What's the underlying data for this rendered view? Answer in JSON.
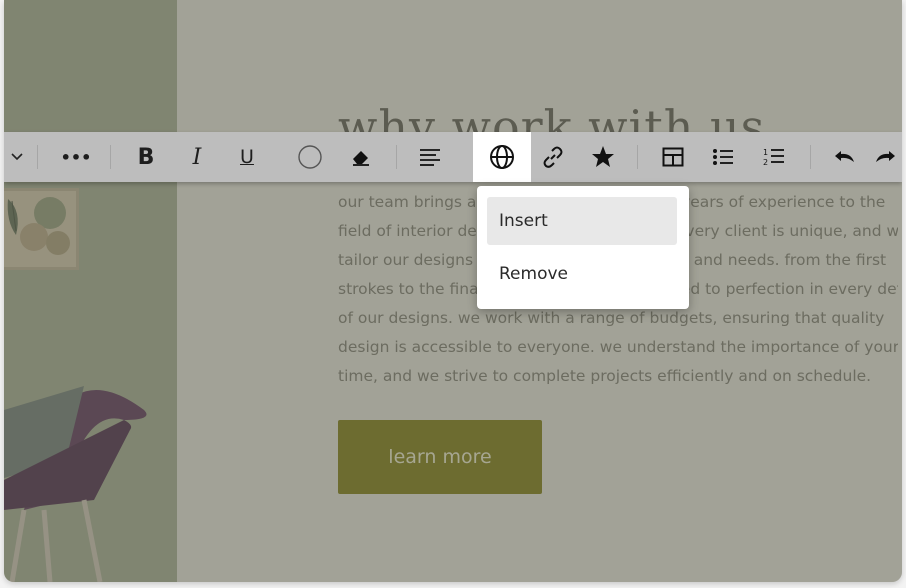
{
  "page": {
    "heading": "why work with us",
    "body_lines": [
      "our team brings a wealth of knowledge and years of experience to the",
      "field of interior design. we understand that every client is unique, and we",
      "tailor our designs to suit your individual style and needs. from the first",
      "strokes to the final touches, we are committed to perfection in every detail",
      "of our designs. we work with a range of budgets, ensuring that quality",
      "design is accessible to everyone. we understand the importance of your",
      "time, and we strive to complete projects efficiently and on schedule."
    ],
    "cta_label": "learn more"
  },
  "toolbar": {
    "more_label": "•••",
    "bold_label": "B",
    "italic_label": "I",
    "underline_label": "U"
  },
  "menu": {
    "items": [
      "Insert",
      "Remove"
    ],
    "highlighted": "Insert"
  },
  "colors": {
    "toolbar_bg": "#bdbdbd",
    "active_bg": "#ffffff",
    "cta_bg": "#7c7a16",
    "menu_highlight": "#e8e8e8"
  }
}
